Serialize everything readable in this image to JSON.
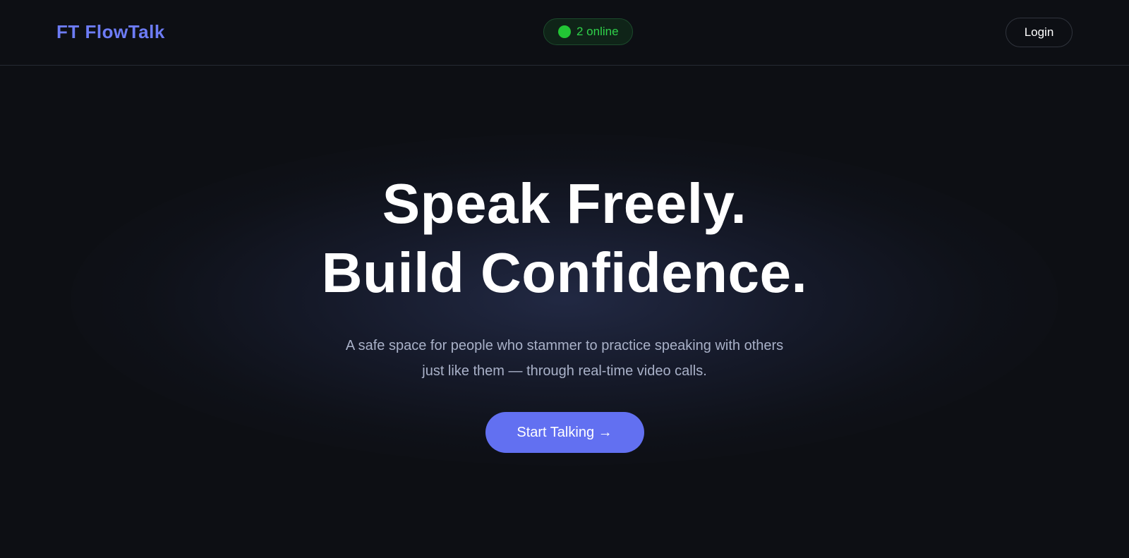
{
  "header": {
    "brand": "FT FlowTalk",
    "online_status": "2 online",
    "login_label": "Login"
  },
  "hero": {
    "headline_line1": "Speak Freely.",
    "headline_line2": "Build Confidence.",
    "subtitle": "A safe space for people who stammer to practice speaking with others just like them — through real-time video calls.",
    "cta_label": "Start Talking →"
  },
  "colors": {
    "background": "#0d0f14",
    "brand_accent": "#6d7cf5",
    "cta": "#6270f1",
    "online_green": "#22c535"
  }
}
